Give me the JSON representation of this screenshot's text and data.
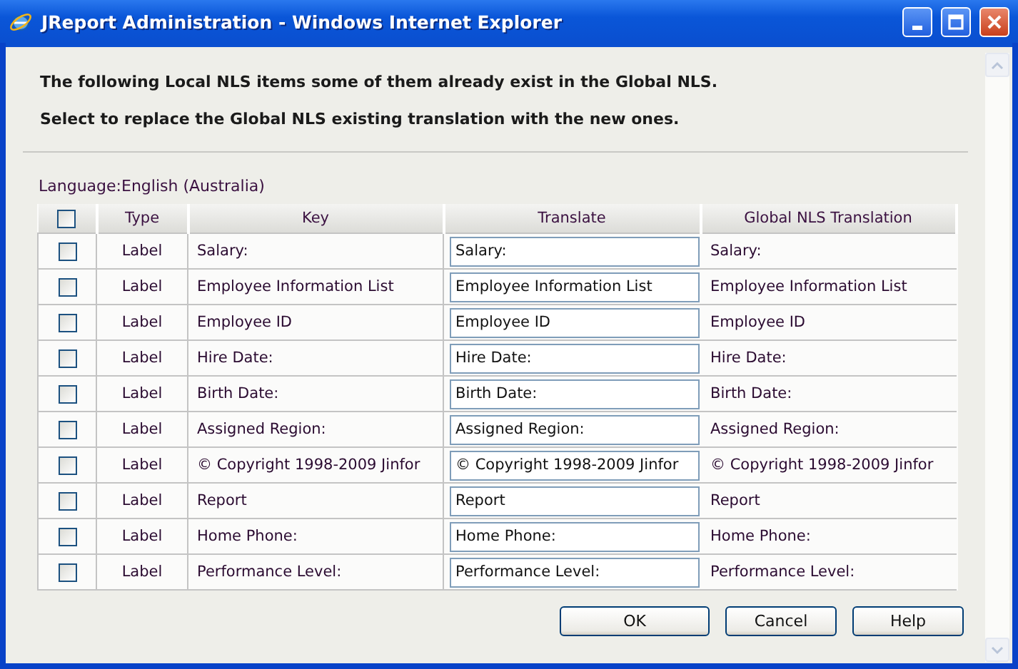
{
  "window": {
    "title": "JReport Administration - Windows Internet Explorer"
  },
  "intro": [
    "The following Local NLS items some of them already exist in the Global NLS.",
    "Select to replace the Global NLS existing translation with the new ones."
  ],
  "language": "Language:English (Australia)",
  "table": {
    "select_all": {
      "checked": false
    },
    "columns": [
      "Type",
      "Key",
      "Translate",
      "Global NLS Translation"
    ],
    "rows": [
      {
        "checked": false,
        "type": "Label",
        "key": "Salary:",
        "translate": "Salary:",
        "global": "Salary:"
      },
      {
        "checked": false,
        "type": "Label",
        "key": "Employee Information List",
        "translate": "Employee Information List",
        "global": "Employee Information List"
      },
      {
        "checked": false,
        "type": "Label",
        "key": "Employee ID",
        "translate": "Employee ID",
        "global": "Employee ID"
      },
      {
        "checked": false,
        "type": "Label",
        "key": "Hire Date:",
        "translate": "Hire Date:",
        "global": "Hire Date:"
      },
      {
        "checked": false,
        "type": "Label",
        "key": "Birth Date:",
        "translate": "Birth Date:",
        "global": "Birth Date:"
      },
      {
        "checked": false,
        "type": "Label",
        "key": "Assigned Region:",
        "translate": "Assigned Region:",
        "global": "Assigned Region:"
      },
      {
        "checked": false,
        "type": "Label",
        "key": "© Copyright 1998-2009 Jinfor",
        "translate": "© Copyright 1998-2009 Jinfor",
        "global": "© Copyright 1998-2009 Jinfor"
      },
      {
        "checked": false,
        "type": "Label",
        "key": "Report",
        "translate": "Report",
        "global": "Report"
      },
      {
        "checked": false,
        "type": "Label",
        "key": "Home Phone:",
        "translate": "Home Phone:",
        "global": "Home Phone:"
      },
      {
        "checked": false,
        "type": "Label",
        "key": "Performance Level:",
        "translate": "Performance Level:",
        "global": "Performance Level:"
      }
    ]
  },
  "buttons": [
    "OK",
    "Cancel",
    "Help"
  ]
}
